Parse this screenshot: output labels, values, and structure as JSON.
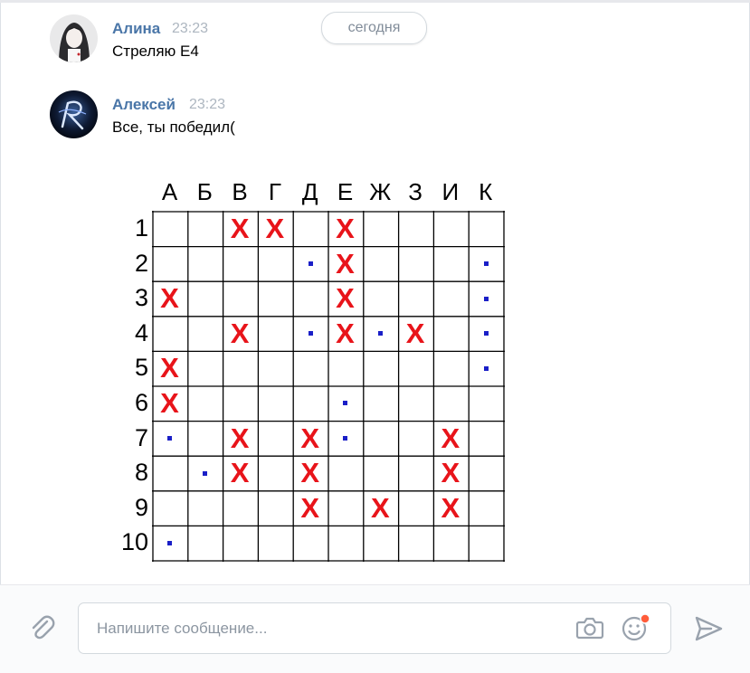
{
  "date_divider": "сегодня",
  "messages": [
    {
      "name": "Алина",
      "time": "23:23",
      "text": "Стреляю Е4"
    },
    {
      "name": "Алексей",
      "time": "23:23",
      "text": "Все, ты победил("
    }
  ],
  "board": {
    "columns": [
      "А",
      "Б",
      "В",
      "Г",
      "Д",
      "Е",
      "Ж",
      "З",
      "И",
      "К"
    ],
    "rows": [
      "1",
      "2",
      "3",
      "4",
      "5",
      "6",
      "7",
      "8",
      "9",
      "10"
    ],
    "hit_symbol": "X",
    "grid": [
      [
        "",
        "",
        "X",
        "X",
        "",
        "X",
        "",
        "",
        "",
        ""
      ],
      [
        "",
        "",
        "",
        "",
        ".",
        "X",
        "",
        "",
        "",
        "."
      ],
      [
        "X",
        "",
        "",
        "",
        "",
        "X",
        "",
        "",
        "",
        "."
      ],
      [
        "",
        "",
        "X",
        "",
        ".",
        "X",
        ".",
        "X",
        "",
        "."
      ],
      [
        "X",
        "",
        "",
        "",
        "",
        "",
        "",
        "",
        "",
        "."
      ],
      [
        "X",
        "",
        "",
        "",
        "",
        ".",
        "",
        "",
        "",
        ""
      ],
      [
        ".",
        "",
        "X",
        "",
        "X",
        ".",
        "",
        "",
        "X",
        ""
      ],
      [
        "",
        ".",
        "X",
        "",
        "X",
        "",
        "",
        "",
        "X",
        ""
      ],
      [
        "",
        "",
        "",
        "",
        "X",
        "",
        "X",
        "",
        "X",
        ""
      ],
      [
        ".",
        "",
        "",
        "",
        "",
        "",
        "",
        "",
        "",
        ""
      ]
    ],
    "colors": {
      "hit": "#e8141a",
      "miss": "#1a1fc7",
      "grid": "#000000"
    }
  },
  "composer": {
    "placeholder": "Напишите сообщение...",
    "icons": [
      "paperclip-icon",
      "camera-icon",
      "emoji-icon",
      "send-icon"
    ]
  },
  "colors": {
    "accent": "#4a76a8",
    "time": "#adb6c0",
    "notification_dot": "#ff5c3a"
  }
}
